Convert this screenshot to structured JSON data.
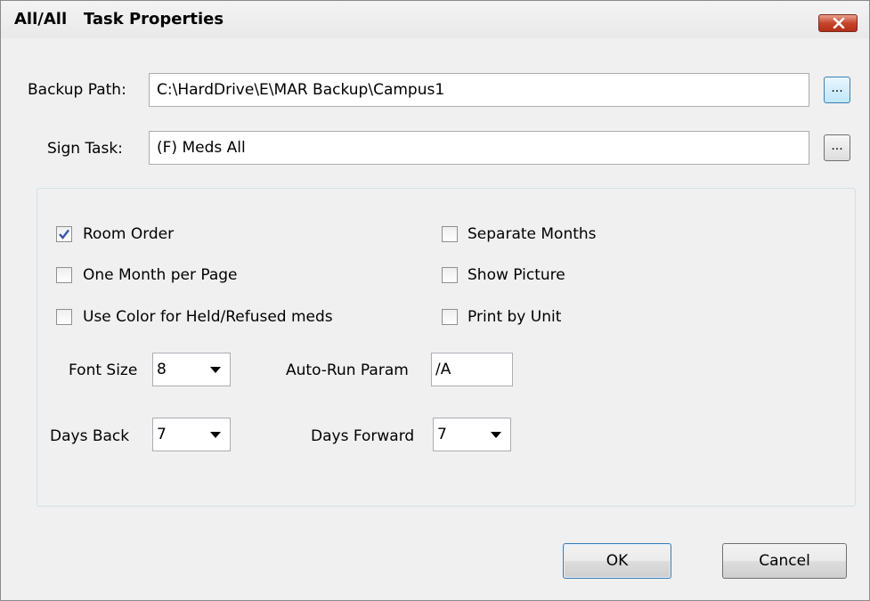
{
  "window": {
    "title": "All/All   Task Properties"
  },
  "backup_path": {
    "label": "Backup Path:",
    "value": "C:\\HardDrive\\E\\MAR Backup\\Campus1",
    "browse_label": "..."
  },
  "sign_task": {
    "label": "Sign Task:",
    "value": "(F) Meds All",
    "browse_label": "..."
  },
  "options": {
    "room_order": {
      "label": "Room Order",
      "checked": true
    },
    "one_month_per_page": {
      "label": "One Month per Page",
      "checked": false
    },
    "use_color": {
      "label": "Use Color for Held/Refused meds",
      "checked": false
    },
    "separate_months": {
      "label": "Separate Months",
      "checked": false
    },
    "show_picture": {
      "label": "Show Picture",
      "checked": false
    },
    "print_by_unit": {
      "label": "Print by Unit",
      "checked": false
    }
  },
  "font_size": {
    "label": "Font Size",
    "value": "8"
  },
  "auto_run": {
    "label": "Auto-Run Param",
    "value": "/A"
  },
  "days_back": {
    "label": "Days Back",
    "value": "7"
  },
  "days_forward": {
    "label": "Days Forward",
    "value": "7"
  },
  "buttons": {
    "ok": "OK",
    "cancel": "Cancel"
  },
  "icons": {
    "close": "close-icon",
    "check": "checkmark-icon",
    "dropdown": "chevron-down-icon"
  },
  "colors": {
    "close_button": "#c7452b",
    "check_mark": "#3a57a8",
    "focus_border": "#3c7fb1"
  }
}
